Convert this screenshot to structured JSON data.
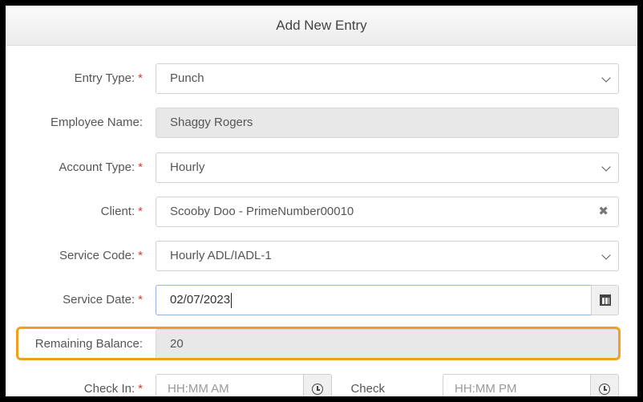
{
  "modal": {
    "title": "Add New Entry"
  },
  "form": {
    "entry_type": {
      "label": "Entry Type:",
      "required": "*",
      "value": "Punch"
    },
    "employee_name": {
      "label": "Employee Name:",
      "value": "Shaggy Rogers"
    },
    "account_type": {
      "label": "Account Type:",
      "required": "*",
      "value": "Hourly"
    },
    "client": {
      "label": "Client:",
      "required": "*",
      "value": "Scooby Doo - PrimeNumber00010",
      "clear_glyph": "✖"
    },
    "service_code": {
      "label": "Service Code:",
      "required": "*",
      "value": "Hourly ADL/IADL-1"
    },
    "service_date": {
      "label": "Service Date:",
      "required": "*",
      "value": "02/07/2023"
    },
    "remaining_balance": {
      "label": "Remaining Balance:",
      "value": "20"
    },
    "check_in": {
      "label": "Check In:",
      "required": "*",
      "placeholder": "HH:MM AM"
    },
    "check_out": {
      "label": "Check",
      "placeholder": "HH:MM PM"
    }
  },
  "icons": {
    "select_arrow": "chevron-down-icon",
    "date_picker": "calendar-icon",
    "time_picker": "clock-icon",
    "clear": "close-icon"
  },
  "colors": {
    "required_star": "#d23a3a",
    "highlight_border": "#f0a020",
    "readonly_bg": "#e8e8e8",
    "focus_border": "#8fb5de"
  }
}
